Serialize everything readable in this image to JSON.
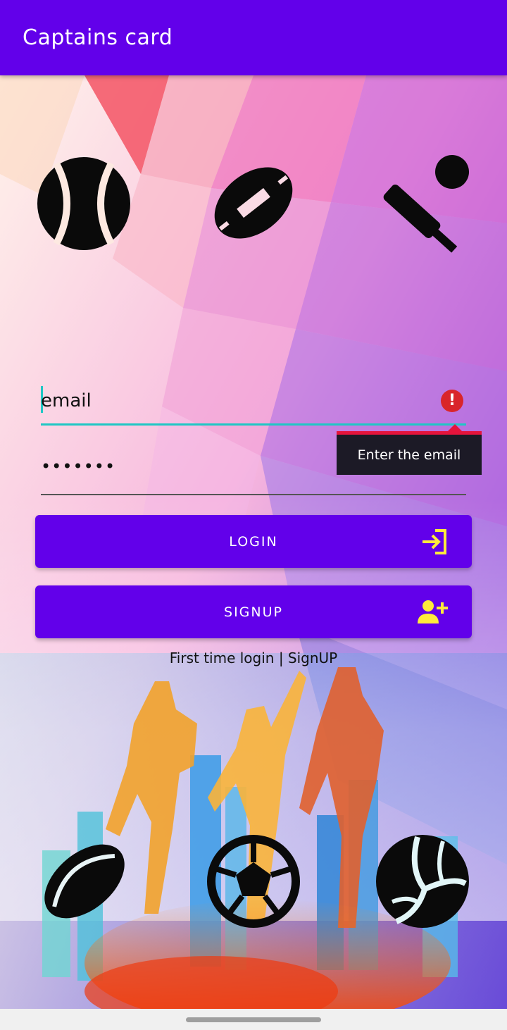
{
  "app_bar": {
    "title": "Captains card"
  },
  "login_form": {
    "email": {
      "value": "email",
      "error_tooltip": "Enter the email"
    },
    "password": {
      "value": "•••••••"
    },
    "login_button": {
      "label": "LOGIN",
      "icon": "login-arrow-icon"
    },
    "signup_button": {
      "label": "SIGNUP",
      "icon": "add-user-icon"
    },
    "signup_link": "First time login | SignUP"
  },
  "top_icons": [
    "tennis-ball-icon",
    "american-football-icon",
    "cricket-bat-ball-icon"
  ],
  "bottom_icons": [
    "rugby-ball-icon",
    "soccer-ball-icon",
    "volleyball-icon"
  ],
  "colors": {
    "primary": "#6200ea",
    "accent": "#1fc7c4",
    "error": "#d9252a",
    "button_icon": "#ffeb3b"
  }
}
